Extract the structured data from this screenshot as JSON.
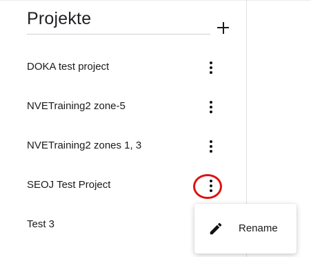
{
  "sidebar": {
    "title": "Projekte",
    "add_icon": "plus-icon",
    "more_icon": "more-vert-icon",
    "projects": [
      {
        "label": "DOKA test project"
      },
      {
        "label": "NVETraining2 zone-5"
      },
      {
        "label": "NVETraining2 zones 1, 3"
      },
      {
        "label": "SEOJ Test Project"
      },
      {
        "label": "Test 3"
      }
    ]
  },
  "context_menu": {
    "items": [
      {
        "label": "Rename",
        "icon": "pencil-icon"
      }
    ]
  },
  "colors": {
    "highlight_ring": "#e01010",
    "text": "#1a1a1a"
  }
}
